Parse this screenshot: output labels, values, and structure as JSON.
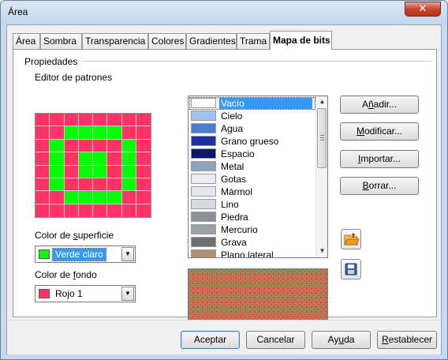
{
  "window": {
    "title": "Área",
    "close_glyph": "✕"
  },
  "tabs": [
    {
      "label": "Área",
      "active": false
    },
    {
      "label": "Sombra",
      "active": false
    },
    {
      "label": "Transparencia",
      "active": false
    },
    {
      "label": "Colores",
      "active": false
    },
    {
      "label": "Gradientes",
      "active": false
    },
    {
      "label": "Trama",
      "active": false
    },
    {
      "label": "Mapa de bits",
      "active": true
    }
  ],
  "properties": {
    "group_title": "Propiedades",
    "pattern_editor_label": "Editor de patrones",
    "pattern": {
      "rows": 8,
      "cols": 8,
      "foreground_color": "#00ff00",
      "background_color": "#ff3366",
      "cells": [
        "00000000",
        "00111100",
        "01000010",
        "01011010",
        "01011010",
        "01000010",
        "00111100",
        "00000000"
      ]
    },
    "surface_color_label_pre": "Color de ",
    "surface_color_label_u": "s",
    "surface_color_label_post": "uperficie",
    "surface_color": {
      "value": "Verde claro",
      "swatch": "#00ff00"
    },
    "background_color_label_pre": "Color de ",
    "background_color_label_u": "f",
    "background_color_label_post": "ondo",
    "background_color": {
      "value": "Rojo 1",
      "swatch": "#ff3366"
    }
  },
  "bitmap_list": {
    "selected": "Vacío",
    "items": [
      {
        "name": "Vacío",
        "swatch": "#ffffff"
      },
      {
        "name": "Cielo",
        "swatch": "#9dc3ee"
      },
      {
        "name": "Agua",
        "swatch": "#4a7fd8"
      },
      {
        "name": "Grano grueso",
        "swatch": "#1f2fa0"
      },
      {
        "name": "Espacio",
        "swatch": "#0b1a66"
      },
      {
        "name": "Metal",
        "swatch": "#8fa4b8"
      },
      {
        "name": "Gotas",
        "swatch": "#e8eef3"
      },
      {
        "name": "Mármol",
        "swatch": "#e3e6ea"
      },
      {
        "name": "Lino",
        "swatch": "#d6dade"
      },
      {
        "name": "Piedra",
        "swatch": "#8c9099"
      },
      {
        "name": "Mercurio",
        "swatch": "#9aa0a8"
      },
      {
        "name": "Grava",
        "swatch": "#6e6e6e"
      },
      {
        "name": "Plano lateral",
        "swatch": "#b09070"
      }
    ]
  },
  "side_buttons": {
    "add": {
      "pre": "A",
      "u": "ñ",
      "post": "adir..."
    },
    "modify": {
      "pre": "",
      "u": "M",
      "post": "odificar..."
    },
    "import": {
      "pre": "",
      "u": "I",
      "post": "mportar..."
    },
    "delete": {
      "pre": "",
      "u": "B",
      "post": "orrar..."
    }
  },
  "icons": {
    "load_list": "open-folder-icon",
    "save_list": "floppy-disk-icon",
    "folder_color": "#e8a020",
    "floppy_color": "#3a5f9f"
  },
  "bottom_buttons": {
    "ok": "Aceptar",
    "cancel": "Cancelar",
    "help_pre": "Ay",
    "help_u": "u",
    "help_post": "da",
    "reset_pre": "",
    "reset_u": "R",
    "reset_post": "establecer"
  }
}
